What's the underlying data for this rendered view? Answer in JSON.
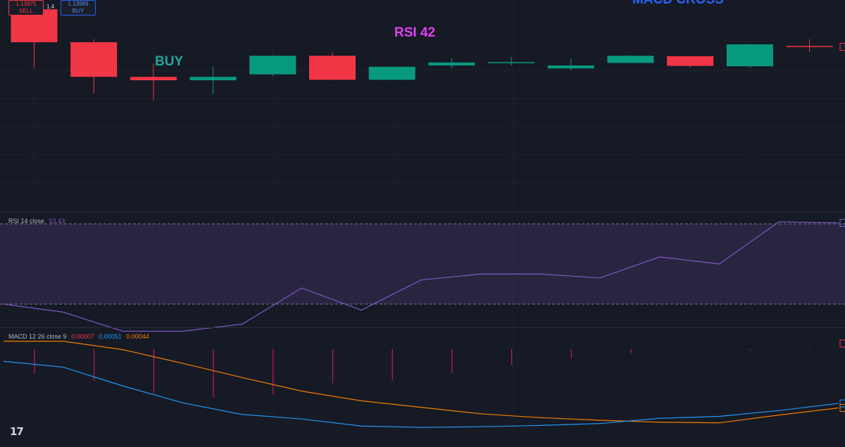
{
  "trade": {
    "sell_price": "1.13975",
    "sell_label": "SELL",
    "spread": "1.4",
    "buy_price": "1.13989",
    "buy_label": "BUY"
  },
  "annotations": {
    "buy": "BUY",
    "rsi": "RSI 42",
    "macd": "MACD CROSS"
  },
  "colors": {
    "up": "#089981",
    "down": "#f23645",
    "rsi_line": "#7e57c2",
    "macd_line": "#2196f3",
    "signal_line": "#f57c00",
    "rsi_annotation": "#e040fb",
    "buy_annotation": "#26a69a",
    "macd_annotation": "#2962ff"
  },
  "rsi_legend": {
    "name": "RSI 14 close",
    "value": "53.43"
  },
  "macd_legend": {
    "name": "MACD 12 26 close 9",
    "hist": "0.00007",
    "macd": "0.00051",
    "signal": "0.00044"
  },
  "logo": "17",
  "chart_data": [
    {
      "type": "candlestick",
      "title": "",
      "price_range": [
        1.136,
        1.141
      ],
      "candles": [
        {
          "o": 1.14078,
          "h": 1.14122,
          "l": 1.1394,
          "c": 1.14
        },
        {
          "o": 1.14,
          "h": 1.14007,
          "l": 1.13879,
          "c": 1.13918
        },
        {
          "o": 1.13918,
          "h": 1.13949,
          "l": 1.13862,
          "c": 1.1391
        },
        {
          "o": 1.1391,
          "h": 1.13942,
          "l": 1.13876,
          "c": 1.13918
        },
        {
          "o": 1.13924,
          "h": 1.13969,
          "l": 1.1392,
          "c": 1.13968
        },
        {
          "o": 1.13968,
          "h": 1.13975,
          "l": 1.13911,
          "c": 1.13911
        },
        {
          "o": 1.13911,
          "h": 1.13942,
          "l": 1.13911,
          "c": 1.13942
        },
        {
          "o": 1.13945,
          "h": 1.13962,
          "l": 1.13938,
          "c": 1.13952
        },
        {
          "o": 1.13952,
          "h": 1.13965,
          "l": 1.13945,
          "c": 1.13953
        },
        {
          "o": 1.13938,
          "h": 1.13962,
          "l": 1.13934,
          "c": 1.13945
        },
        {
          "o": 1.13951,
          "h": 1.13969,
          "l": 1.1395,
          "c": 1.13968
        },
        {
          "o": 1.13967,
          "h": 1.13967,
          "l": 1.1394,
          "c": 1.13944
        },
        {
          "o": 1.13943,
          "h": 1.13996,
          "l": 1.1394,
          "c": 1.13995
        },
        {
          "o": 1.13991,
          "h": 1.14007,
          "l": 1.13977,
          "c": 1.13989
        }
      ]
    },
    {
      "type": "line",
      "title": "RSI 14 close",
      "ylim": [
        0,
        100
      ],
      "bands": [
        70,
        30
      ],
      "x": [
        0,
        1,
        2,
        3,
        4,
        5,
        6,
        7,
        8,
        9,
        10,
        11,
        12,
        13,
        14
      ],
      "series": [
        {
          "name": "RSI",
          "values": [
            30,
            26,
            16.5,
            16.5,
            20,
            38,
            27,
            42,
            45,
            45,
            43,
            53.5,
            50,
            71,
            70.5
          ]
        }
      ]
    },
    {
      "type": "line",
      "title": "MACD 12 26 close 9",
      "ylim": [
        0.0,
        0.0015
      ],
      "x": [
        0,
        1,
        2,
        3,
        4,
        5,
        6,
        7,
        8,
        9,
        10,
        11,
        12,
        13,
        14
      ],
      "series": [
        {
          "name": "MACD",
          "values": [
            0.00116,
            0.00107,
            0.00078,
            0.00052,
            0.00034,
            0.00027,
            0.00016,
            0.00014,
            0.00015,
            0.00017,
            0.0002,
            0.00028,
            0.00031,
            0.0004,
            0.00051
          ]
        },
        {
          "name": "Signal",
          "values": [
            0.00147,
            0.00147,
            0.00134,
            0.00113,
            0.00091,
            0.0007,
            0.00055,
            0.00045,
            0.00035,
            0.00029,
            0.00025,
            0.00022,
            0.00021,
            0.00033,
            0.00044
          ]
        }
      ],
      "histogram": [
        -0.00031,
        -0.0004,
        -0.00056,
        -0.00061,
        -0.00057,
        -0.00043,
        -0.00039,
        -0.00031,
        -0.0002,
        -0.00012,
        -5e-05,
        6e-05,
        0.0001,
        7e-05,
        7e-05
      ]
    }
  ]
}
